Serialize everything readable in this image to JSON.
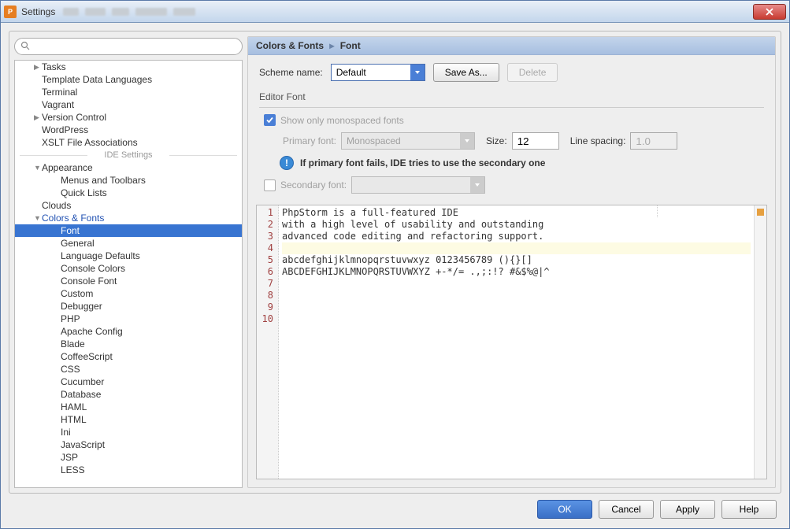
{
  "window": {
    "title": "Settings"
  },
  "sidebar": {
    "search_placeholder": "",
    "top_items": [
      {
        "label": "Tasks",
        "expandable": true
      },
      {
        "label": "Template Data Languages"
      },
      {
        "label": "Terminal"
      },
      {
        "label": "Vagrant"
      },
      {
        "label": "Version Control",
        "expandable": true
      },
      {
        "label": "WordPress"
      },
      {
        "label": "XSLT File Associations"
      }
    ],
    "divider": "IDE Settings",
    "ide_items": [
      {
        "label": "Appearance",
        "expandable": true,
        "expanded": true,
        "children": [
          {
            "label": "Menus and Toolbars"
          },
          {
            "label": "Quick Lists"
          }
        ]
      },
      {
        "label": "Clouds"
      },
      {
        "label": "Colors & Fonts",
        "expandable": true,
        "expanded": true,
        "highlight": true,
        "children": [
          {
            "label": "Font",
            "selected": true
          },
          {
            "label": "General"
          },
          {
            "label": "Language Defaults"
          },
          {
            "label": "Console Colors"
          },
          {
            "label": "Console Font"
          },
          {
            "label": "Custom"
          },
          {
            "label": "Debugger"
          },
          {
            "label": "PHP"
          },
          {
            "label": "Apache Config"
          },
          {
            "label": "Blade"
          },
          {
            "label": "CoffeeScript"
          },
          {
            "label": "CSS"
          },
          {
            "label": "Cucumber"
          },
          {
            "label": "Database"
          },
          {
            "label": "HAML"
          },
          {
            "label": "HTML"
          },
          {
            "label": "Ini"
          },
          {
            "label": "JavaScript"
          },
          {
            "label": "JSP"
          },
          {
            "label": "LESS"
          }
        ]
      }
    ]
  },
  "breadcrumb": {
    "parent": "Colors & Fonts",
    "current": "Font"
  },
  "form": {
    "scheme_label": "Scheme name:",
    "scheme_value": "Default",
    "save_as": "Save As...",
    "delete": "Delete",
    "editor_font_title": "Editor Font",
    "mono_checkbox": "Show only monospaced fonts",
    "primary_font_label": "Primary font:",
    "primary_font_value": "Monospaced",
    "size_label": "Size:",
    "size_value": "12",
    "line_spacing_label": "Line spacing:",
    "line_spacing_value": "1.0",
    "info_text": "If primary font fails, IDE tries to use the secondary one",
    "secondary_font_label": "Secondary font:",
    "secondary_font_value": ""
  },
  "preview": {
    "lines": [
      "PhpStorm is a full-featured IDE",
      "with a high level of usability and outstanding",
      "advanced code editing and refactoring support.",
      "",
      "abcdefghijklmnopqrstuvwxyz 0123456789 (){}[]",
      "ABCDEFGHIJKLMNOPQRSTUVWXYZ +-*/= .,;:!? #&$%@|^",
      "",
      "",
      "",
      ""
    ],
    "highlight_line": 3
  },
  "footer": {
    "ok": "OK",
    "cancel": "Cancel",
    "apply": "Apply",
    "help": "Help"
  }
}
